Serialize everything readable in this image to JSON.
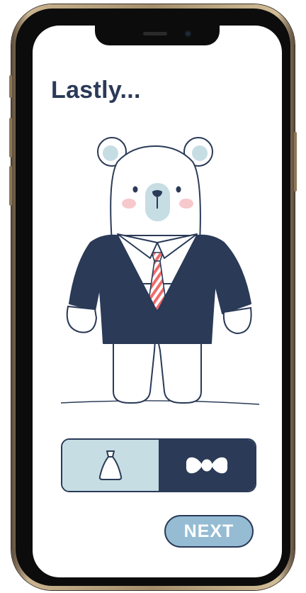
{
  "screen": {
    "title": "Lastly...",
    "options": [
      {
        "icon": "dress-icon",
        "selected": false
      },
      {
        "icon": "bowtie-icon",
        "selected": true
      }
    ],
    "next_label": "NEXT"
  },
  "colors": {
    "navy": "#2a3a57",
    "light_blue": "#c6dde3",
    "button_blue": "#95bcd3",
    "tie_red": "#f06a6a",
    "cheek_pink": "#f7c8cc"
  }
}
